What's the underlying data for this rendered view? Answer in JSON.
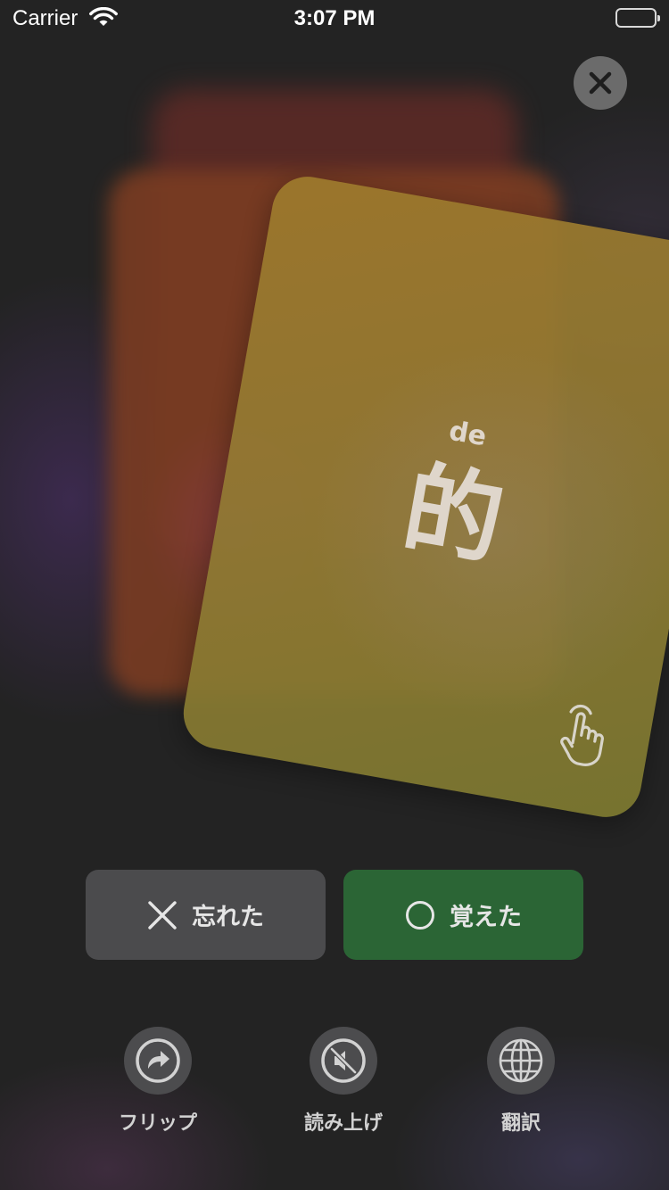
{
  "status_bar": {
    "carrier": "Carrier",
    "time": "3:07 PM"
  },
  "card": {
    "pinyin": "de",
    "hanzi": "的"
  },
  "actions": {
    "forgot_label": "忘れた",
    "remembered_label": "覚えた"
  },
  "tools": [
    {
      "label": "フリップ",
      "icon": "flip-icon"
    },
    {
      "label": "読み上げ",
      "icon": "speaker-muted-icon"
    },
    {
      "label": "翻訳",
      "icon": "globe-icon"
    }
  ],
  "colors": {
    "background": "#232323",
    "card": "#927a34",
    "forgot_button": "#4b4b4d",
    "remembered_button": "#2b6535"
  }
}
